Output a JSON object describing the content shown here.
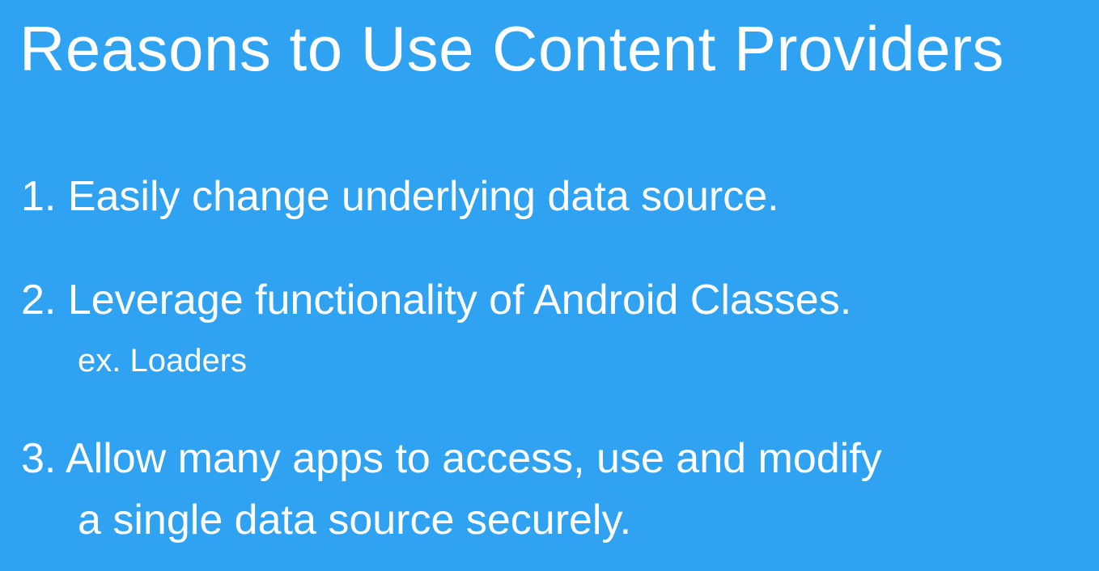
{
  "slide": {
    "title": "Reasons to Use Content Providers",
    "points": [
      {
        "number": "1.",
        "text": "Easily change underlying data source."
      },
      {
        "number": "2.",
        "text": "Leverage functionality of Android Classes.",
        "sub": "ex. Loaders"
      },
      {
        "number": "3.",
        "text": "Allow many apps to access, use and modify",
        "continuation": "a single data source securely."
      }
    ]
  },
  "colors": {
    "background": "#2fa2f2",
    "text": "#ffffff"
  }
}
